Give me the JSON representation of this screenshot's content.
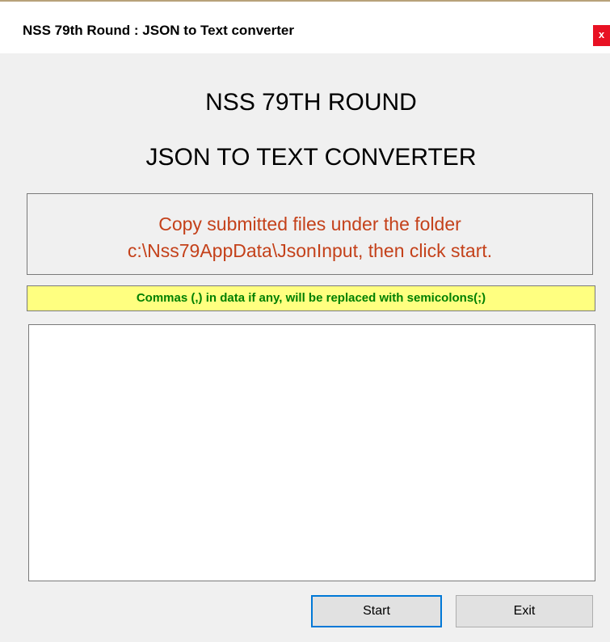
{
  "window": {
    "title": "NSS 79th Round : JSON to Text converter",
    "close_label": "x"
  },
  "form": {
    "heading_line1": "NSS 79TH ROUND",
    "heading_line2": "JSON TO TEXT CONVERTER",
    "instruction_line1": "Copy submitted files under the folder",
    "instruction_line2": "c:\\Nss79AppData\\JsonInput, then click start.",
    "note": "Commas (,) in data if any, will be replaced with semicolons(;)",
    "output_text": ""
  },
  "buttons": {
    "start_label": "Start",
    "exit_label": "Exit"
  },
  "colors": {
    "instruction_text": "#c4411a",
    "note_text": "#008000",
    "note_background": "#ffff80",
    "close_button": "#e81123",
    "focus_border": "#0078d7"
  }
}
